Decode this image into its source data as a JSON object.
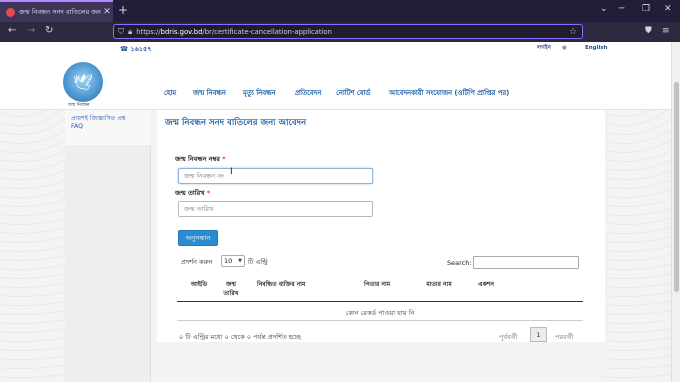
{
  "browser": {
    "tab_title": "জন্ম নিবন্ধন সনদ বাতিলের জন্য আবেদন",
    "url_domain": "bdris.gov.bd",
    "url_path": "/br/certificate-cancellation-application",
    "url_scheme": "https://"
  },
  "topbar": {
    "phone": "☎ ১৬১৫৭",
    "login": "লগইন",
    "language": "English"
  },
  "header": {
    "logo_caption": "জন্ম নিবন্ধন",
    "menu": [
      "হোম",
      "জন্ম নিবন্ধন",
      "মৃত্যু নিবন্ধন",
      "প্রতিবেদন",
      "নোটিশ বোর্ড",
      "আবেদনকারী সংযোজন (ওটিপি প্রাপ্তির পর)"
    ]
  },
  "sidebar": {
    "links": [
      "প্রায়শই জিজ্ঞাসিত প্রশ্ন",
      "FAQ"
    ]
  },
  "form": {
    "title": "জন্ম নিবন্ধন সনদ বাতিলের জন্য আবেদন",
    "reg_no_label": "জন্ম নিবন্ধন নম্বর",
    "reg_no_placeholder": "জন্ম নিবন্ধন নং",
    "dob_label": "জন্ম তারিখ",
    "dob_placeholder": "জন্ম তারিখ",
    "required_mark": "*",
    "apply_button": "অনুসন্ধান"
  },
  "table": {
    "show_label": "প্রদর্শন করুন",
    "page_size": "10",
    "entries_label": "টি এন্ট্রি",
    "search_label": "Search:",
    "columns": [
      "আইডি",
      "জন্ম তারিখ",
      "নিবন্ধিত ব্যক্তির নাম",
      "পিতার নাম",
      "মাতার নাম",
      "একশন"
    ],
    "empty_message": "কোন রেকর্ড পাওয়া যায় নি",
    "info": "০ টি এন্ট্রির মধ্যে ০ থেকে ০ পর্যন্ত প্রদর্শিত হচ্ছে",
    "prev_label": "পূর্ববর্তী",
    "current_page": "1",
    "next_label": "পরবর্তী"
  },
  "icons": {
    "back": "back-arrow-icon",
    "forward": "forward-arrow-icon",
    "reload": "reload-icon",
    "shield": "shield-icon",
    "lock": "lock-icon",
    "star": "bookmark-star-icon",
    "pocket": "pocket-icon",
    "menu": "hamburger-menu-icon",
    "user": "user-icon",
    "phone": "phone-icon"
  }
}
